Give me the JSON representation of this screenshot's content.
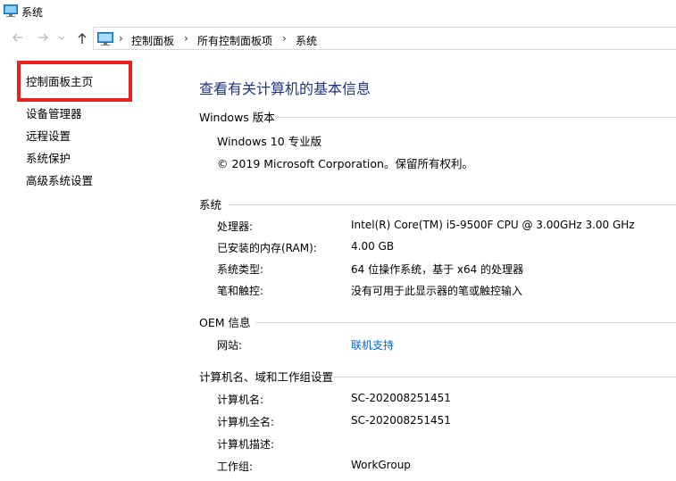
{
  "window": {
    "title": "系统",
    "icon": "computer-system-icon"
  },
  "navigation": {
    "back_icon": "arrow-left-icon",
    "forward_icon": "arrow-right-icon",
    "recent_icon": "chevron-down-icon",
    "up_icon": "arrow-up-icon",
    "breadcrumbs": [
      "控制面板",
      "所有控制面板项",
      "系统"
    ]
  },
  "sidebar": {
    "items": [
      {
        "label": "控制面板主页"
      },
      {
        "label": "设备管理器"
      },
      {
        "label": "远程设置"
      },
      {
        "label": "系统保护"
      },
      {
        "label": "高级系统设置"
      }
    ],
    "highlight_color": "#e8231d"
  },
  "main": {
    "title": "查看有关计算机的基本信息",
    "windows_edition": {
      "heading": "Windows 版本",
      "edition": "Windows 10 专业版",
      "copyright": "© 2019 Microsoft Corporation。保留所有权利。"
    },
    "system": {
      "heading": "系统",
      "rows": [
        {
          "label": "处理器:",
          "value": "Intel(R) Core(TM) i5-9500F CPU @ 3.00GHz   3.00 GHz"
        },
        {
          "label": "已安装的内存(RAM):",
          "value": "4.00 GB"
        },
        {
          "label": "系统类型:",
          "value": "64 位操作系统，基于 x64 的处理器"
        },
        {
          "label": "笔和触控:",
          "value": "没有可用于此显示器的笔或触控输入"
        }
      ]
    },
    "oem": {
      "heading": "OEM 信息",
      "rows": [
        {
          "label": "网站:",
          "value": "联机支持"
        }
      ]
    },
    "computer": {
      "heading": "计算机名、域和工作组设置",
      "rows": [
        {
          "label": "计算机名:",
          "value": "SC-202008251451"
        },
        {
          "label": "计算机全名:",
          "value": "SC-202008251451"
        },
        {
          "label": "计算机描述:",
          "value": ""
        },
        {
          "label": "工作组:",
          "value": "WorkGroup"
        }
      ]
    },
    "title_color": "#1e3287",
    "link_color": "#0066cc"
  }
}
